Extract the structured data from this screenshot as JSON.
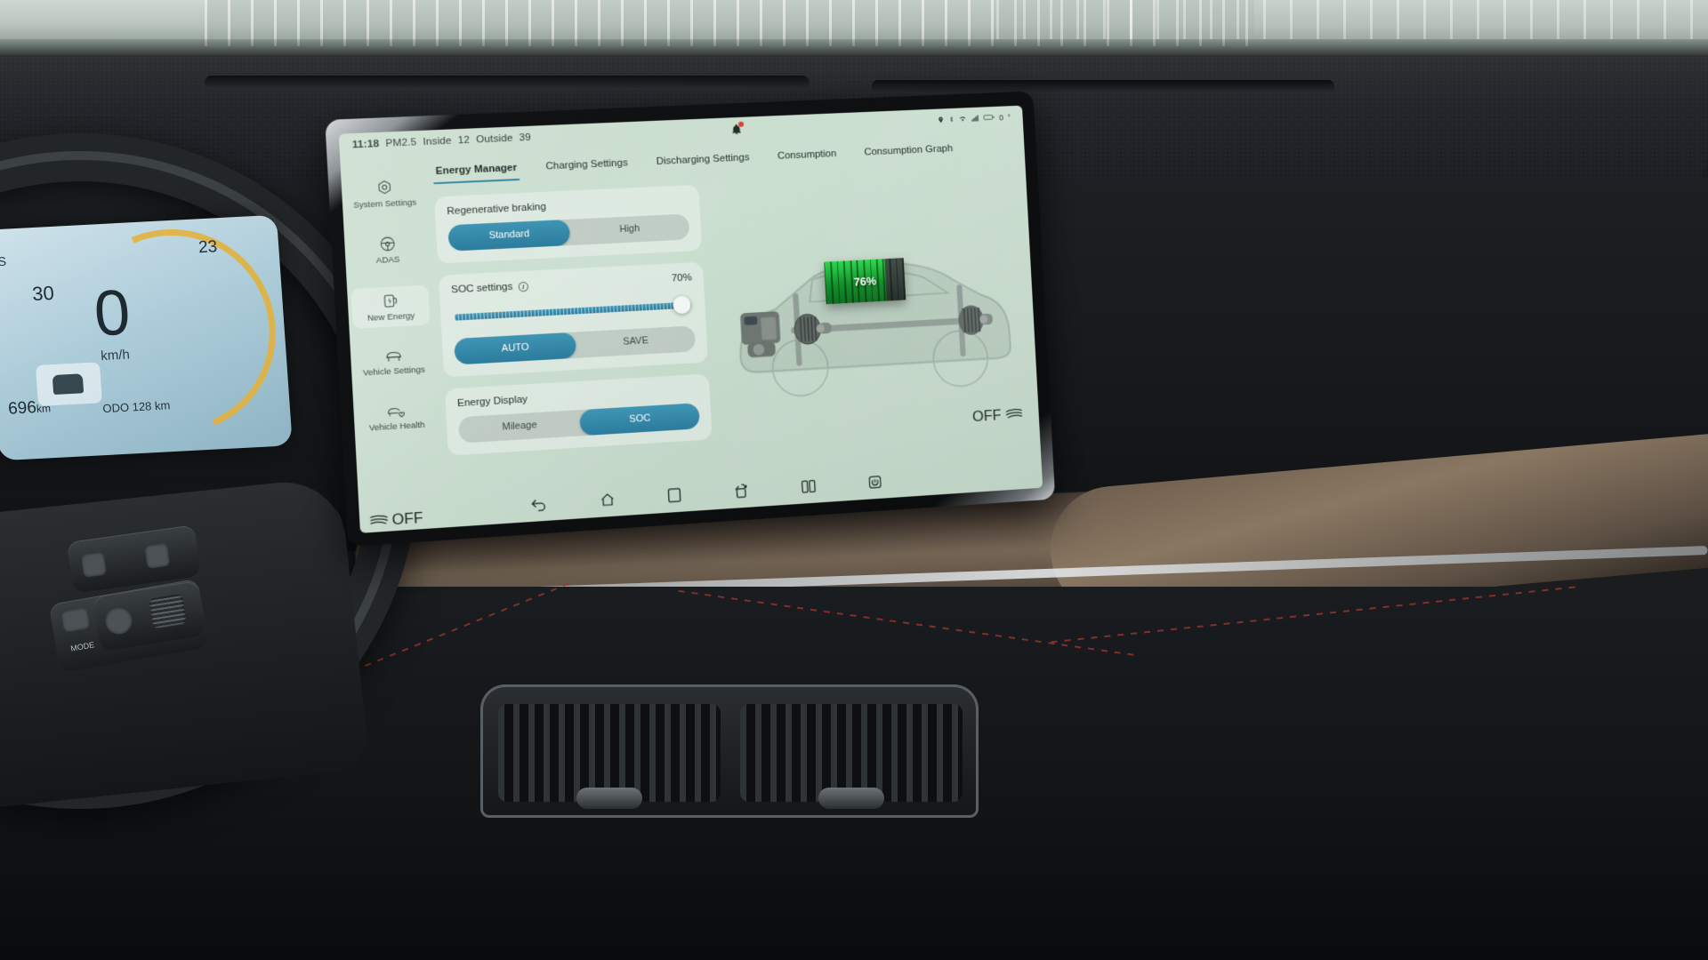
{
  "status_bar": {
    "time": "11:18",
    "pm25_label": "PM2.5",
    "inside_label": "Inside",
    "inside_value": "12",
    "outside_label": "Outside",
    "outside_value": "39",
    "notification_icon": "bell-icon",
    "right_icons": [
      "location-icon",
      "bluetooth-icon",
      "wifi-icon",
      "signal-icon",
      "battery-icon"
    ],
    "battery_text": "0"
  },
  "sidebar": {
    "items": [
      {
        "label": "System Settings",
        "icon": "gear-hex-icon",
        "active": false
      },
      {
        "label": "ADAS",
        "icon": "steering-wheel-icon",
        "active": false
      },
      {
        "label": "New Energy",
        "icon": "ev-charge-icon",
        "active": true
      },
      {
        "label": "Vehicle Settings",
        "icon": "car-seat-icon",
        "active": false
      },
      {
        "label": "Vehicle Health",
        "icon": "car-heart-icon",
        "active": false
      }
    ]
  },
  "tabs": [
    {
      "label": "Energy Manager",
      "active": true
    },
    {
      "label": "Charging  Settings",
      "active": false
    },
    {
      "label": "Discharging Settings",
      "active": false
    },
    {
      "label": "Consumption",
      "active": false
    },
    {
      "label": "Consumption Graph",
      "active": false
    }
  ],
  "cards": {
    "regen": {
      "title": "Regenerative braking",
      "options": [
        "Standard",
        "High"
      ],
      "selected": "Standard"
    },
    "soc": {
      "title": "SOC settings",
      "info_icon": "info-circle-icon",
      "value_label": "70%",
      "value": 70,
      "mode_options": [
        "AUTO",
        "SAVE"
      ],
      "mode_selected": "AUTO"
    },
    "energy_display": {
      "title": "Energy Display",
      "options": [
        "Mileage",
        "SOC"
      ],
      "selected": "SOC"
    }
  },
  "vehicle_diagram": {
    "battery_percent_label": "76%",
    "battery_percent": 76,
    "components": [
      "motor-icon",
      "front-axle-icon",
      "battery-pack",
      "rear-axle-icon"
    ]
  },
  "nav_bar": {
    "items": [
      {
        "icon": "back-icon",
        "label": "Back"
      },
      {
        "icon": "home-icon",
        "label": "Home"
      },
      {
        "icon": "recents-icon",
        "label": "Recents"
      },
      {
        "icon": "screenshot-icon",
        "label": "Screenshot"
      },
      {
        "icon": "split-screen-icon",
        "label": "Split Screen"
      },
      {
        "icon": "power-icon",
        "label": "Power"
      }
    ]
  },
  "climate": {
    "left_status": "OFF",
    "right_status": "OFF",
    "fan_icon": "fan-lines-icon"
  },
  "cluster": {
    "speed": "0",
    "unit": "km/h",
    "speed_limit": "30",
    "temperature": "23",
    "gear": "S",
    "range": "696",
    "range_unit": "km",
    "odo_label": "ODO",
    "odo_value": "128",
    "odo_unit": "km"
  },
  "steering_wheel": {
    "mode_label": "MODE"
  },
  "colors": {
    "accent": "#2b7f9e",
    "screen_bg": "#c9dccd",
    "battery_green": "#16a52d",
    "badge_red": "#e23b2e"
  }
}
